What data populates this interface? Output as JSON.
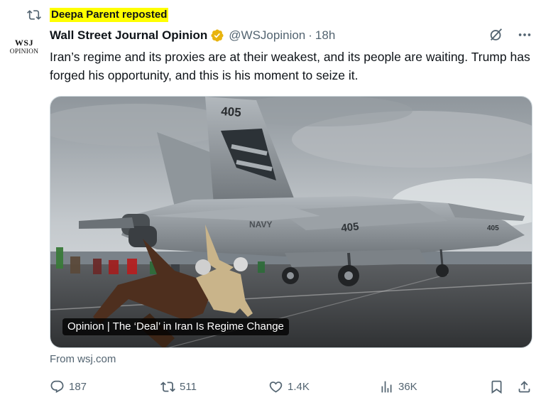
{
  "repost": {
    "label": "Deepa Parent reposted",
    "icon": "repost-icon"
  },
  "author": {
    "avatar_line1": "WSJ",
    "avatar_line2": "OPINION",
    "name": "Wall Street Journal Opinion",
    "verified_badge": "gold-verified-badge",
    "handle": "@WSJopinion",
    "separator": "·",
    "time": "18h"
  },
  "tweet": {
    "text": "Iran’s regime and its proxies are at their weakest, and its people are waiting. Trump has forged his opportunity, and this is his moment to seize it."
  },
  "media": {
    "caption": "Opinion | The ‘Deal’ in Iran Is Regime Change",
    "tail_number": "405",
    "fuselage_number": "405",
    "nose_number": "405",
    "navy_label": "NAVY"
  },
  "link": {
    "from": "From wsj.com"
  },
  "actions": {
    "replies": "187",
    "reposts": "511",
    "likes": "1.4K",
    "views": "36K"
  },
  "colors": {
    "accent_blue": "#1d9bf0",
    "verified_gold": "#e8b40f",
    "muted_text": "#536471",
    "highlight": "#ffff00"
  }
}
